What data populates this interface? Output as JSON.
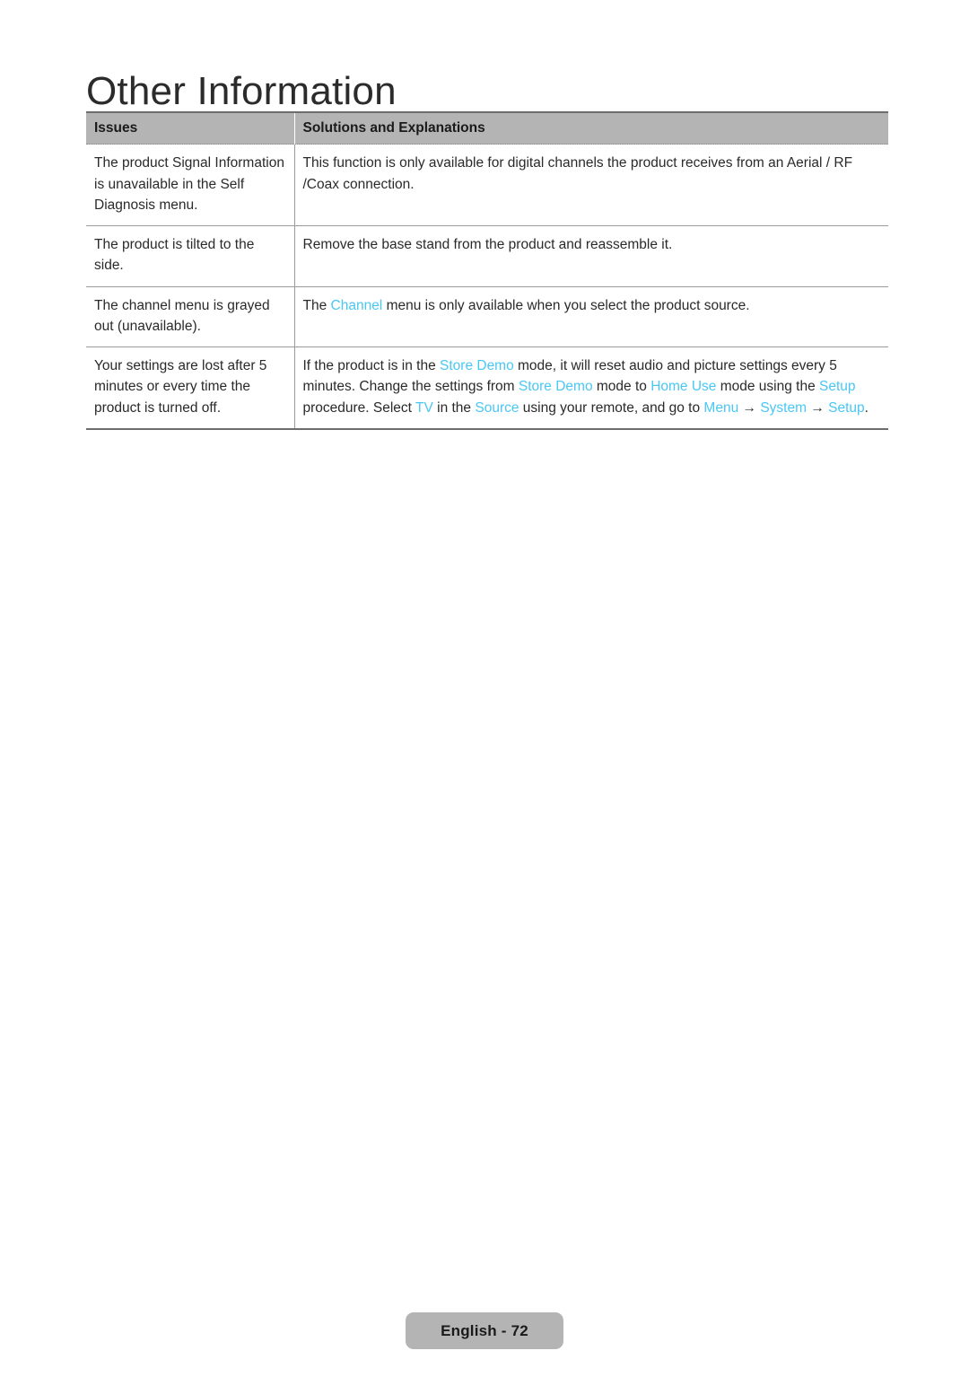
{
  "page": {
    "title": "Other Information",
    "footer_label": "English - 72"
  },
  "colors": {
    "highlight": "#49c7f4",
    "header_background": "#b4b4b4",
    "text": "#2a2a2a",
    "footer_pill_background": "#b4b4b4"
  },
  "table": {
    "headers": {
      "issues": "Issues",
      "solutions": "Solutions and Explanations"
    },
    "rows": [
      {
        "issue": "The product Signal Information is unavailable in the Self Diagnosis menu.",
        "solution_parts": [
          {
            "text": "This function is only available for digital channels the product receives from an Aerial / RF /Coax connection.",
            "highlight": false
          }
        ],
        "solution_plain": "This function is only available for digital channels the product receives from an Aerial / RF /Coax connection."
      },
      {
        "issue": "The product is tilted to the side.",
        "solution_parts": [
          {
            "text": "Remove the base stand from the product and reassemble it.",
            "highlight": false
          }
        ],
        "solution_plain": "Remove the base stand from the product and reassemble it."
      },
      {
        "issue": "The channel menu is grayed out (unavailable).",
        "solution_parts": [
          {
            "text": "The ",
            "highlight": false
          },
          {
            "text": "Channel",
            "highlight": true
          },
          {
            "text": " menu is only available when you select the product source.",
            "highlight": false
          }
        ],
        "solution_plain": "The Channel menu is only available when you select the product source."
      },
      {
        "issue": "Your settings are lost after 5 minutes or every time the product is turned off.",
        "solution_parts": [
          {
            "text": "If the product is in the ",
            "highlight": false
          },
          {
            "text": "Store Demo",
            "highlight": true
          },
          {
            "text": " mode, it will reset audio and picture settings every 5 minutes. Change the settings from ",
            "highlight": false
          },
          {
            "text": "Store Demo",
            "highlight": true
          },
          {
            "text": " mode to ",
            "highlight": false
          },
          {
            "text": "Home Use",
            "highlight": true
          },
          {
            "text": " mode using the ",
            "highlight": false
          },
          {
            "text": "Setup",
            "highlight": true
          },
          {
            "text": " procedure. Select ",
            "highlight": false
          },
          {
            "text": "TV",
            "highlight": true
          },
          {
            "text": " in the ",
            "highlight": false
          },
          {
            "text": "Source",
            "highlight": true
          },
          {
            "text": " using your remote, and go to ",
            "highlight": false
          },
          {
            "text": "Menu",
            "highlight": true
          },
          {
            "text": " → ",
            "highlight": false
          },
          {
            "text": "System",
            "highlight": true
          },
          {
            "text": " → ",
            "highlight": false
          },
          {
            "text": "Setup",
            "highlight": true
          },
          {
            "text": ".",
            "highlight": false
          }
        ],
        "solution_plain": "If the product is in the Store Demo mode, it will reset audio and picture settings every 5 minutes. Change the settings from Store Demo mode to Home Use mode using the Setup procedure. Select TV in the Source using your remote, and go to Menu → System → Setup."
      }
    ]
  }
}
